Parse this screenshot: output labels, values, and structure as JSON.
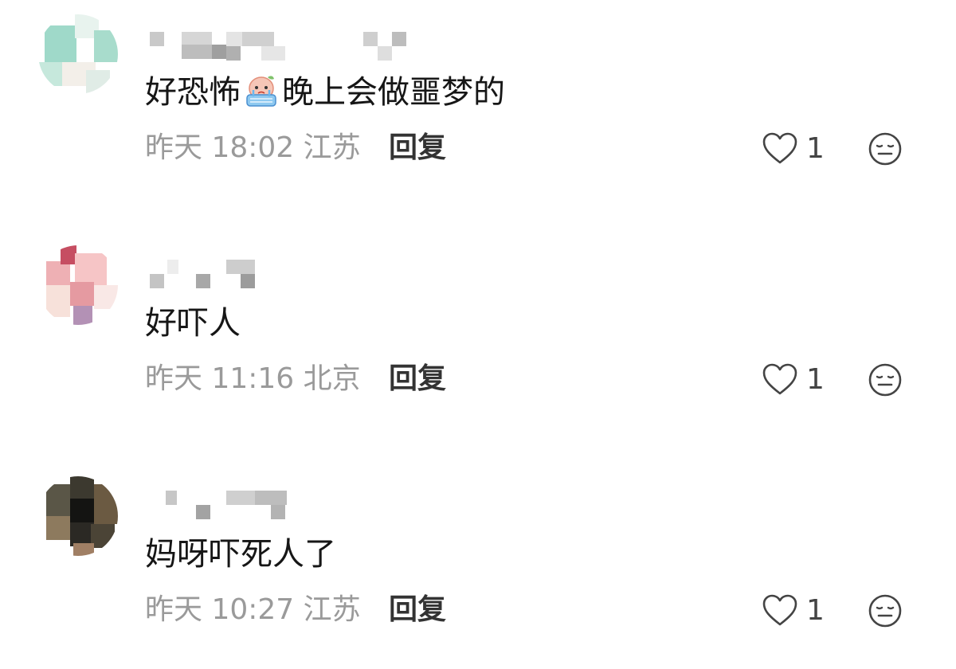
{
  "comments": [
    {
      "text_before": "好恐怖",
      "emoji": "crying-peach-emoji",
      "text_after": "晚上会做噩梦的",
      "time": "昨天 18:02",
      "location": "江苏",
      "reply_label": "回复",
      "likes": "1",
      "avatar_colors": [
        "#9fd9c9",
        "#c9ece3",
        "#f4f1ec",
        "#b9e3d6",
        "#e6efe9"
      ]
    },
    {
      "text_before": "好吓人",
      "emoji": "",
      "text_after": "",
      "time": "昨天 11:16",
      "location": "北京",
      "reply_label": "回复",
      "likes": "1",
      "avatar_colors": [
        "#e89aa3",
        "#f5c1c1",
        "#c64e62",
        "#f7dede",
        "#b89ab8"
      ]
    },
    {
      "text_before": "妈呀吓死人了",
      "emoji": "",
      "text_after": "",
      "time": "昨天 10:27",
      "location": "江苏",
      "reply_label": "回复",
      "likes": "1",
      "avatar_colors": [
        "#4e4a3d",
        "#2b2924",
        "#7a6a55",
        "#a08468",
        "#5e5545"
      ]
    }
  ],
  "icons": {
    "like": "heart-outline-icon",
    "dislike": "neutral-face-icon"
  }
}
